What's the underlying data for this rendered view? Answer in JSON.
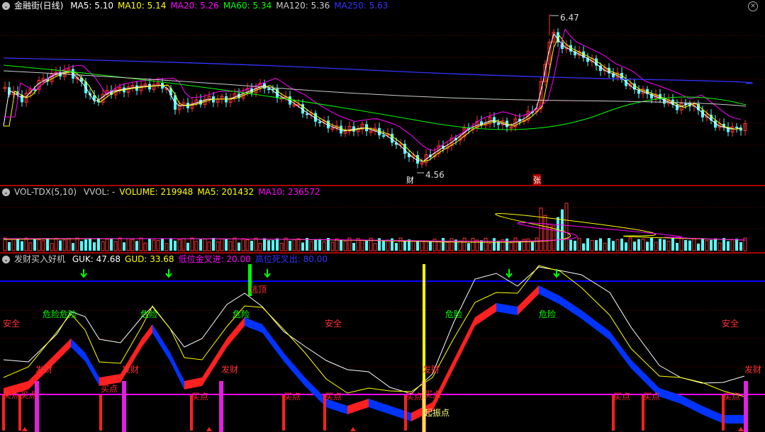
{
  "price_panel": {
    "title": "金融街(日线)",
    "indicators": [
      {
        "label": "MA5: 5.10",
        "color": "#ffffff"
      },
      {
        "label": "MA10: 5.14",
        "color": "#ffff00"
      },
      {
        "label": "MA20: 5.26",
        "color": "#ff00ff"
      },
      {
        "label": "MA60: 5.34",
        "color": "#00ff00"
      },
      {
        "label": "MA120: 5.36",
        "color": "#cccccc"
      },
      {
        "label": "MA250: 5.63",
        "color": "#3333ff"
      }
    ],
    "high_label": "6.47",
    "low_label": "4.56",
    "marker_cai": "财",
    "marker_zhang": "张"
  },
  "volume_panel": {
    "title": "VOL-TDX(5,10)",
    "indicators": [
      {
        "label": "VVOL: -",
        "color": "#cccccc"
      },
      {
        "label": "VOLUME: 219948",
        "color": "#ffff00"
      },
      {
        "label": "MA5: 201432",
        "color": "#ffff00"
      },
      {
        "label": "MA10: 236572",
        "color": "#ff00ff"
      }
    ]
  },
  "indicator_panel": {
    "title": "发财买入好机",
    "indicators": [
      {
        "label": "GUK: 47.68",
        "color": "#ffffff"
      },
      {
        "label": "GUD: 33.68",
        "color": "#ffff00"
      },
      {
        "label": "低位金叉进: 20.00",
        "color": "#ff00ff"
      },
      {
        "label": "高位死叉出: 80.00",
        "color": "#3333ff"
      }
    ],
    "labels": {
      "safe": "安全",
      "danger": "危险",
      "danger_double": "危险危险",
      "fortune": "发财",
      "buy": "买点",
      "escape": "逃顶",
      "start": "起振点"
    }
  },
  "colors": {
    "up": "#ff3232",
    "down": "#54ffff",
    "grid": "#8b0000"
  }
}
